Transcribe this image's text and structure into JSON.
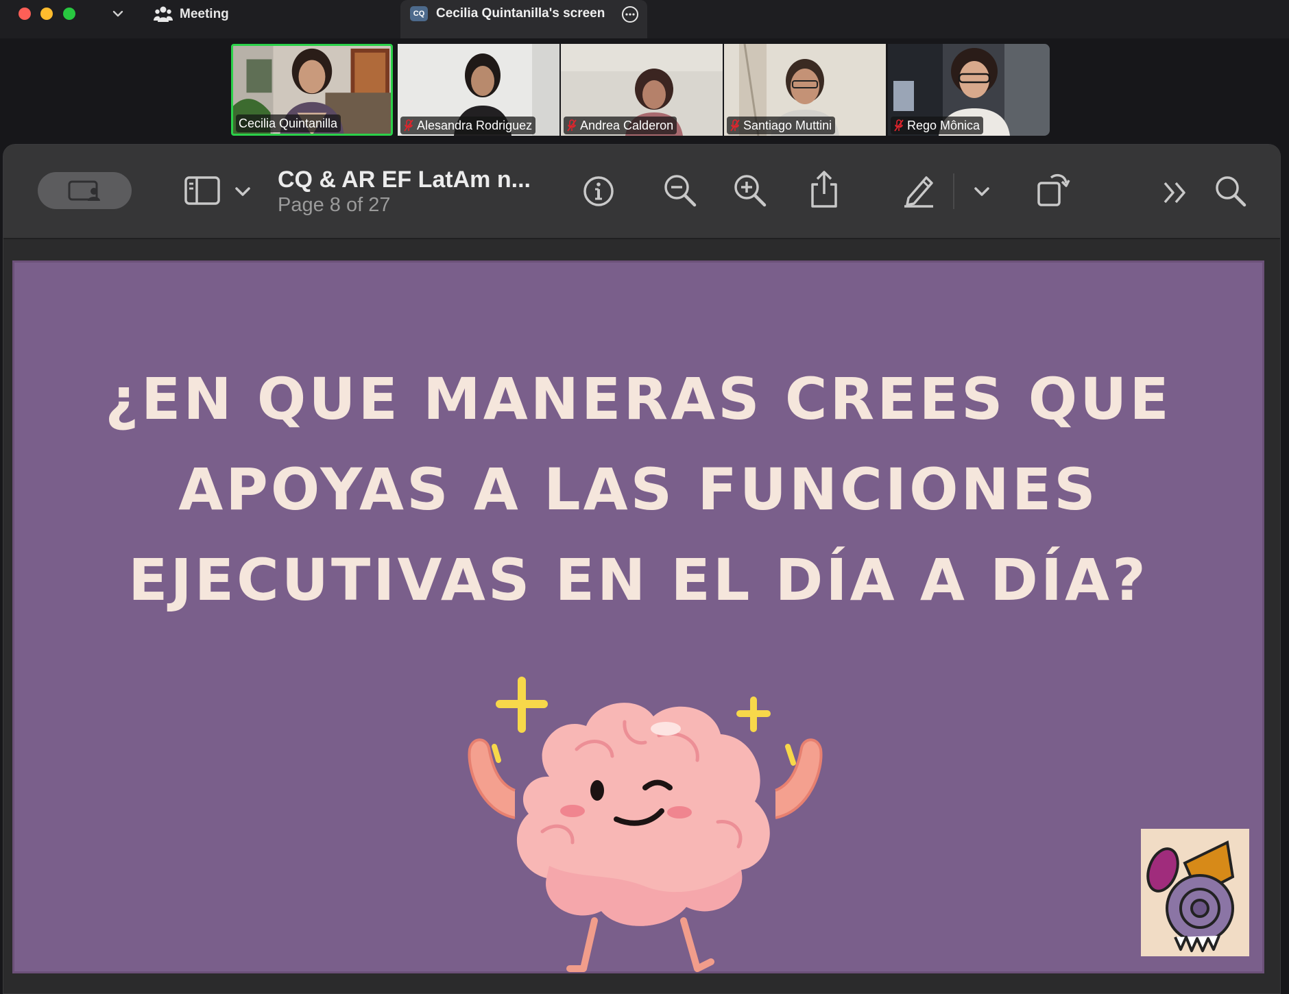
{
  "titlebar": {
    "meeting_label": "Meeting",
    "screen_tab_badge": "CQ",
    "screen_tab_label": "Cecilia Quintanilla's screen"
  },
  "participants": [
    {
      "name": "Cecilia Quintanilla",
      "muted": false,
      "active_speaker": true
    },
    {
      "name": "Alesandra Rodriguez",
      "muted": true,
      "active_speaker": false
    },
    {
      "name": "Andrea Calderon",
      "muted": true,
      "active_speaker": false
    },
    {
      "name": "Santiago Muttini",
      "muted": true,
      "active_speaker": false
    },
    {
      "name": "Rego Mônica",
      "muted": true,
      "active_speaker": false
    }
  ],
  "viewer": {
    "doc_title": "CQ & AR EF LatAm n...",
    "page_indicator": "Page 8 of 27"
  },
  "slide": {
    "line1": "¿EN QUE MANERAS CREES QUE",
    "line2": "APOYAS A LAS FUNCIONES",
    "line3": "EJECUTIVAS EN EL DÍA A DÍA?"
  },
  "colors": {
    "slide_bg": "#7a5f8b",
    "slide_text": "#f5e6dc",
    "active_speaker_border": "#2bd14a",
    "mute_icon": "#e0242c"
  }
}
